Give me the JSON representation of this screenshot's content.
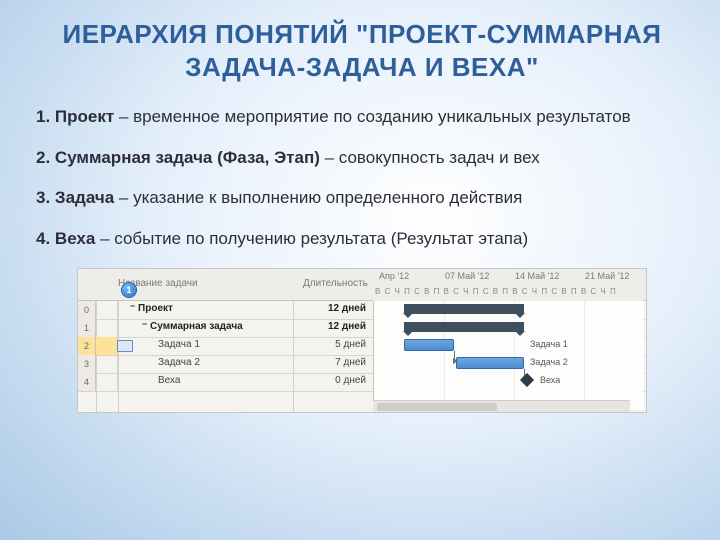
{
  "title": "ИЕРАРХИЯ ПОНЯТИЙ \"ПРОЕКТ-СУММАРНАЯ ЗАДАЧА-ЗАДАЧА И ВЕХА\"",
  "list": {
    "i1": {
      "num": "1.",
      "term": "Проект",
      "rest": " – временное мероприятие по созданию уникальных результатов"
    },
    "i2": {
      "num": "2.",
      "term": "Суммарная задача (Фаза, Этап)",
      "rest": " – совокупность задач и вех"
    },
    "i3": {
      "num": "3.",
      "term": "Задача",
      "rest": " – указание к выполнению определенного действия"
    },
    "i4": {
      "num": "4.",
      "term": "Веха",
      "rest": " – событие по получению результата (Результат этапа)"
    }
  },
  "shot": {
    "badge1": "1",
    "header": {
      "taskname": "Название задачи",
      "duration": "Длительность",
      "info": ""
    },
    "weeks": {
      "w0": "Апр '12",
      "w1": "07 Май '12",
      "w2": "14 Май '12",
      "w3": "21 Май '12"
    },
    "days": "В С Ч П С В П В С Ч П С В П В С Ч П С В П В С Ч П",
    "rows": {
      "r0": {
        "id": "0",
        "name": "⁻ Проект",
        "dur": "12 дней"
      },
      "r1": {
        "id": "1",
        "name": "⁻ Суммарная задача",
        "dur": "12 дней"
      },
      "r2": {
        "id": "2",
        "name": "Задача 1",
        "dur": "5 дней"
      },
      "r3": {
        "id": "3",
        "name": "Задача 2",
        "dur": "7 дней"
      },
      "r4": {
        "id": "4",
        "name": "Веха",
        "dur": "0 дней"
      }
    },
    "labels": {
      "t1": "Задача 1",
      "t2": "Задача 2",
      "m": "Веха"
    }
  }
}
